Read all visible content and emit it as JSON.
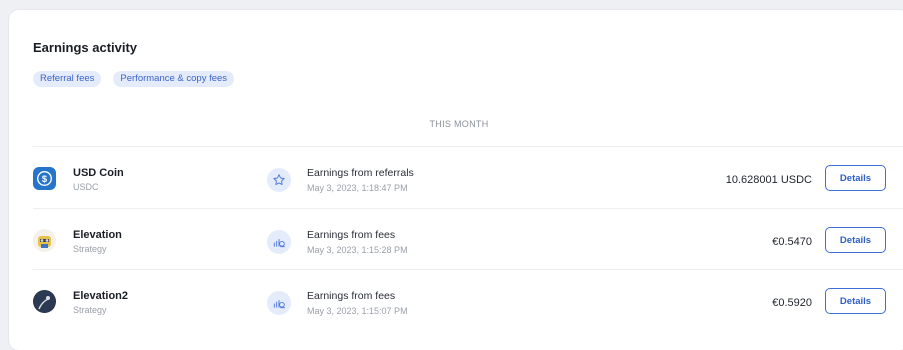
{
  "section": {
    "title": "Earnings activity",
    "filters": [
      "Referral fees",
      "Performance & copy fees"
    ],
    "period_label": "THIS MONTH"
  },
  "rows": [
    {
      "asset_name": "USD Coin",
      "asset_sub": "USDC",
      "asset_icon": "usdc-coin-icon",
      "type_icon": "star-icon",
      "type_label": "Earnings from referrals",
      "date": "May 3, 2023, 1:18:47 PM",
      "amount": "10.628001 USDC",
      "action": "Details"
    },
    {
      "asset_name": "Elevation",
      "asset_sub": "Strategy",
      "asset_icon": "strategy-avatar-icon",
      "type_icon": "coins-chart-icon",
      "type_label": "Earnings from fees",
      "date": "May 3, 2023, 1:15:28 PM",
      "amount": "€0.5470",
      "action": "Details"
    },
    {
      "asset_name": "Elevation2",
      "asset_sub": "Strategy",
      "asset_icon": "strategy-avatar-icon",
      "type_icon": "coins-chart-icon",
      "type_label": "Earnings from fees",
      "date": "May 3, 2023, 1:15:07 PM",
      "amount": "€0.5920",
      "action": "Details"
    }
  ],
  "colors": {
    "accent": "#3b6fd4",
    "chip_bg": "#e4ecfb",
    "usdc_blue": "#2775ca"
  }
}
